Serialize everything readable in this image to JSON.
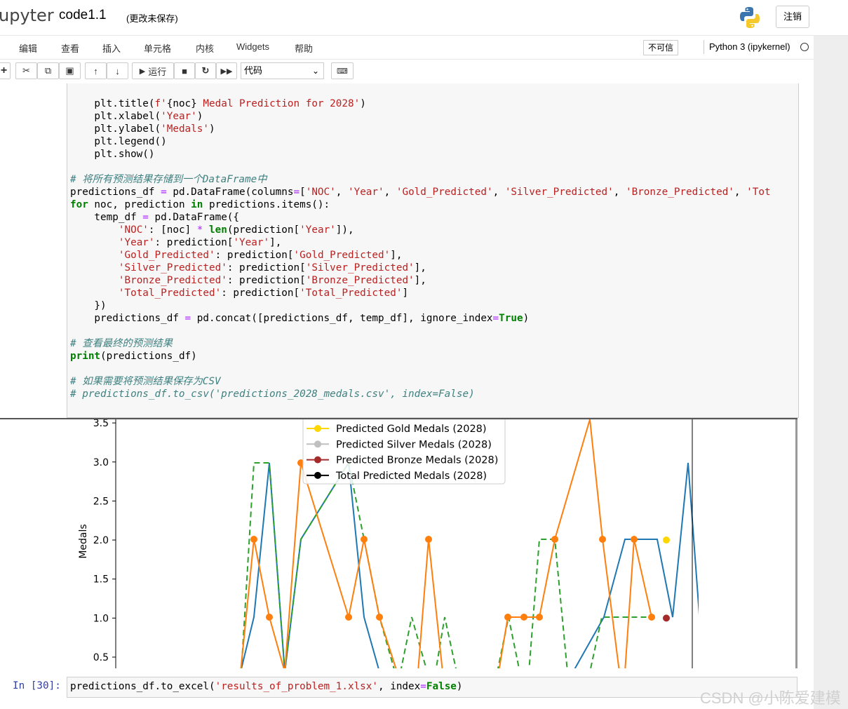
{
  "header": {
    "logo": "upyter",
    "notebook_name": "code1.1",
    "save_status": "(更改未保存)",
    "logout": "注销"
  },
  "menu": {
    "items": [
      "编辑",
      "查看",
      "插入",
      "单元格",
      "内核",
      "Widgets",
      "帮助"
    ],
    "trusted": "不可信",
    "kernel": "Python 3 (ipykernel)"
  },
  "toolbar": {
    "run_label": "运行",
    "cell_type": "代码"
  },
  "code_lines": [
    [
      [
        "",
        "    plt.title("
      ],
      [
        "str",
        "f'"
      ],
      [
        "",
        "{noc}"
      ],
      [
        "str",
        " Medal Prediction for 2028'"
      ],
      [
        "",
        ")"
      ]
    ],
    [
      [
        "",
        "    plt.xlabel("
      ],
      [
        "str",
        "'Year'"
      ],
      [
        "",
        ")"
      ]
    ],
    [
      [
        "",
        "    plt.ylabel("
      ],
      [
        "str",
        "'Medals'"
      ],
      [
        "",
        ")"
      ]
    ],
    [
      [
        "",
        "    plt.legend()"
      ]
    ],
    [
      [
        "",
        "    plt.show()"
      ]
    ],
    [
      [
        "",
        ""
      ]
    ],
    [
      [
        "cm",
        "# 将所有预测结果存储到一个DataFrame中"
      ]
    ],
    [
      [
        "",
        "predictions_df "
      ],
      [
        "op",
        "="
      ],
      [
        "",
        " pd.DataFrame(columns"
      ],
      [
        "op",
        "="
      ],
      [
        "",
        "["
      ],
      [
        "str",
        "'NOC'"
      ],
      [
        "",
        ", "
      ],
      [
        "str",
        "'Year'"
      ],
      [
        "",
        ", "
      ],
      [
        "str",
        "'Gold_Predicted'"
      ],
      [
        "",
        ", "
      ],
      [
        "str",
        "'Silver_Predicted'"
      ],
      [
        "",
        ", "
      ],
      [
        "str",
        "'Bronze_Predicted'"
      ],
      [
        "",
        ", "
      ],
      [
        "str",
        "'Tot"
      ]
    ],
    [
      [
        "kw",
        "for"
      ],
      [
        "",
        " noc, prediction "
      ],
      [
        "kw",
        "in"
      ],
      [
        "",
        " predictions.items():"
      ]
    ],
    [
      [
        "",
        "    temp_df "
      ],
      [
        "op",
        "="
      ],
      [
        "",
        " pd.DataFrame({"
      ]
    ],
    [
      [
        "",
        "        "
      ],
      [
        "str",
        "'NOC'"
      ],
      [
        "",
        ": [noc] "
      ],
      [
        "op",
        "*"
      ],
      [
        "",
        " "
      ],
      [
        "kw",
        "len"
      ],
      [
        "",
        "(prediction["
      ],
      [
        "str",
        "'Year'"
      ],
      [
        "",
        "]),"
      ]
    ],
    [
      [
        "",
        "        "
      ],
      [
        "str",
        "'Year'"
      ],
      [
        "",
        ": prediction["
      ],
      [
        "str",
        "'Year'"
      ],
      [
        "",
        "],"
      ]
    ],
    [
      [
        "",
        "        "
      ],
      [
        "str",
        "'Gold_Predicted'"
      ],
      [
        "",
        ": prediction["
      ],
      [
        "str",
        "'Gold_Predicted'"
      ],
      [
        "",
        "],"
      ]
    ],
    [
      [
        "",
        "        "
      ],
      [
        "str",
        "'Silver_Predicted'"
      ],
      [
        "",
        ": prediction["
      ],
      [
        "str",
        "'Silver_Predicted'"
      ],
      [
        "",
        "],"
      ]
    ],
    [
      [
        "",
        "        "
      ],
      [
        "str",
        "'Bronze_Predicted'"
      ],
      [
        "",
        ": prediction["
      ],
      [
        "str",
        "'Bronze_Predicted'"
      ],
      [
        "",
        "],"
      ]
    ],
    [
      [
        "",
        "        "
      ],
      [
        "str",
        "'Total_Predicted'"
      ],
      [
        "",
        ": prediction["
      ],
      [
        "str",
        "'Total_Predicted'"
      ],
      [
        "",
        "]"
      ]
    ],
    [
      [
        "",
        "    })"
      ]
    ],
    [
      [
        "",
        "    predictions_df "
      ],
      [
        "op",
        "="
      ],
      [
        "",
        " pd.concat([predictions_df, temp_df], ignore_index"
      ],
      [
        "op",
        "="
      ],
      [
        "kw",
        "True"
      ],
      [
        "",
        ")"
      ]
    ],
    [
      [
        "",
        ""
      ]
    ],
    [
      [
        "cm",
        "# 查看最终的预测结果"
      ]
    ],
    [
      [
        "kw",
        "print"
      ],
      [
        "",
        "(predictions_df)"
      ]
    ],
    [
      [
        "",
        ""
      ]
    ],
    [
      [
        "cm",
        "# 如果需要将预测结果保存为CSV"
      ]
    ],
    [
      [
        "cm",
        "# predictions_df.to_csv('predictions_2028_medals.csv', index=False)"
      ]
    ]
  ],
  "chart_data": {
    "type": "line",
    "ylabel": "Medals",
    "y_ticks": [
      "0.5",
      "1.0",
      "1.5",
      "2.0",
      "2.5",
      "3.0",
      "3.5"
    ],
    "legend": [
      {
        "label": "Predicted Gold Medals (2028)",
        "color": "#ffd700"
      },
      {
        "label": "Predicted Silver Medals (2028)",
        "color": "#c0c0c0"
      },
      {
        "label": "Predicted Bronze Medals (2028)",
        "color": "#a52a2a"
      },
      {
        "label": "Total Predicted Medals (2028)",
        "color": "#000000"
      }
    ],
    "legend_placement": "top-center",
    "series_colors": {
      "blue": "#1f77b4",
      "orange": "#ff7f0e",
      "green": "#2ca02c"
    },
    "predicted_points": {
      "gold": 2.0,
      "bronze": 1.0
    }
  },
  "cell2": {
    "prompt": "In [30]:",
    "code_pre": "predictions_df.to_excel(",
    "code_str": "'results_of_problem_1.xlsx'",
    "code_mid": ", index",
    "code_eq": "=",
    "code_kw": "False",
    "code_end": ")"
  },
  "watermark": "CSDN @小陈爱建模"
}
